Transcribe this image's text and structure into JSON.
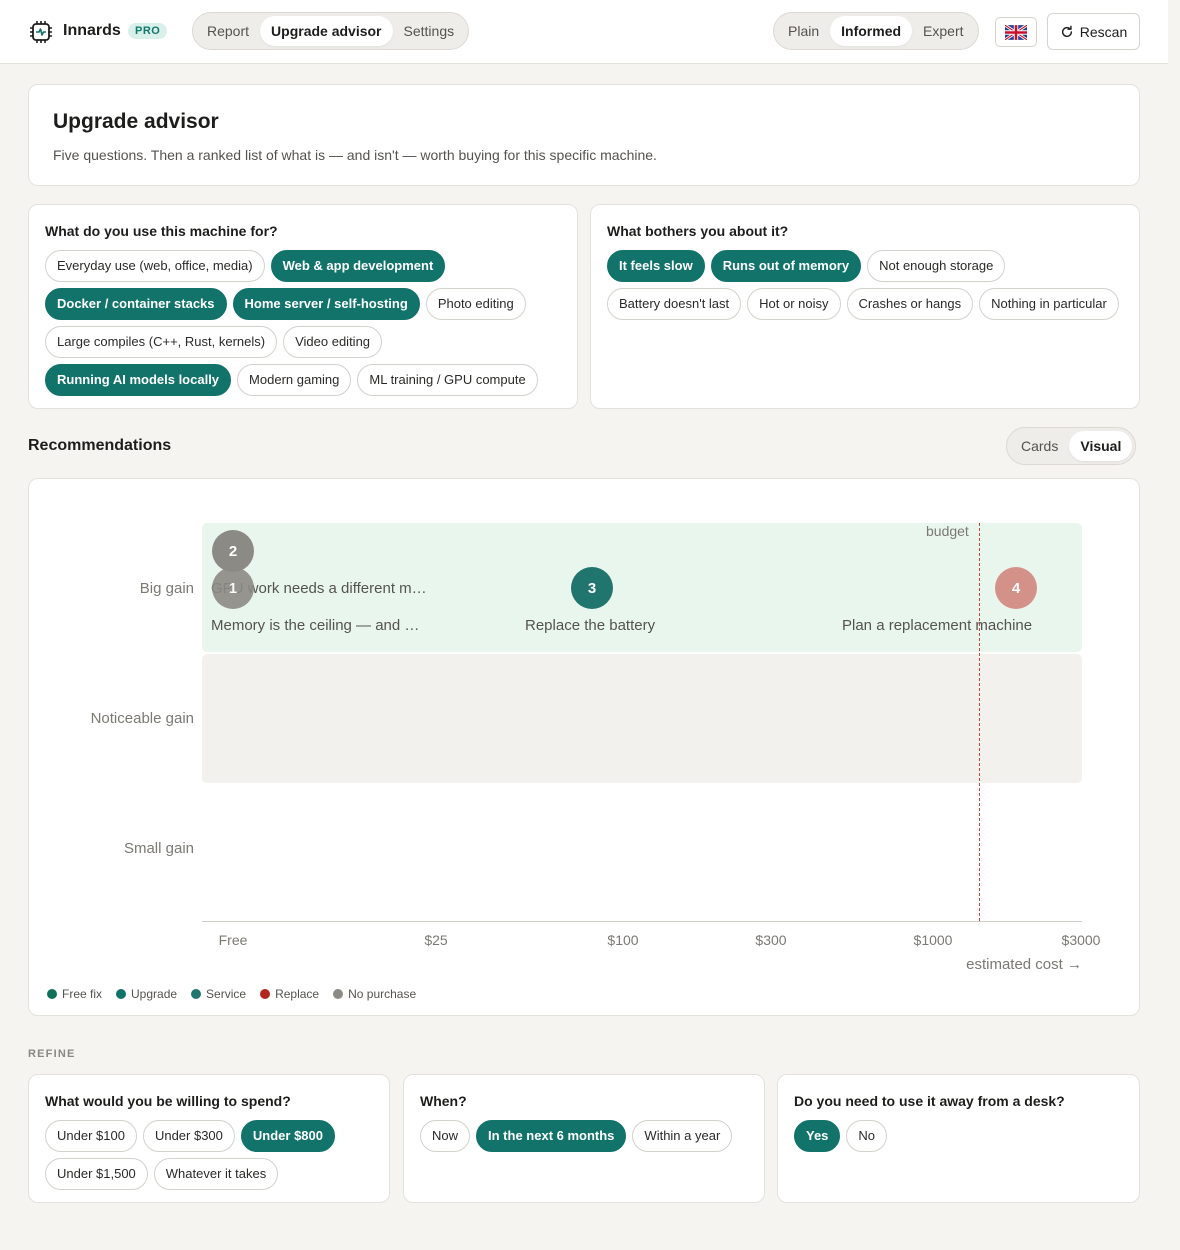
{
  "app": {
    "name": "Innards",
    "badge": "PRO"
  },
  "nav": {
    "tabs": [
      {
        "label": "Report"
      },
      {
        "label": "Upgrade advisor"
      },
      {
        "label": "Settings"
      }
    ]
  },
  "modes": {
    "items": [
      {
        "label": "Plain"
      },
      {
        "label": "Informed"
      },
      {
        "label": "Expert"
      }
    ]
  },
  "language": {
    "flag": "🇬🇧"
  },
  "rescan_label": "Rescan",
  "intro": {
    "title": "Upgrade advisor",
    "subtitle": "Five questions. Then a ranked list of what is — and isn't — worth buying for this specific machine."
  },
  "q_use": {
    "title": "What do you use this machine for?",
    "chips": [
      {
        "label": "Everyday use (web, office, media)",
        "on": false
      },
      {
        "label": "Web & app development",
        "on": true
      },
      {
        "label": "Docker / container stacks",
        "on": true
      },
      {
        "label": "Home server / self-hosting",
        "on": true
      },
      {
        "label": "Photo editing",
        "on": false
      },
      {
        "label": "Large compiles (C++, Rust, kernels)",
        "on": false
      },
      {
        "label": "Video editing",
        "on": false
      },
      {
        "label": "Running AI models locally",
        "on": true
      },
      {
        "label": "Modern gaming",
        "on": false
      },
      {
        "label": "ML training / GPU compute",
        "on": false
      }
    ]
  },
  "q_bother": {
    "title": "What bothers you about it?",
    "chips": [
      {
        "label": "It feels slow",
        "on": true
      },
      {
        "label": "Runs out of memory",
        "on": true
      },
      {
        "label": "Not enough storage",
        "on": false
      },
      {
        "label": "Battery doesn't last",
        "on": false
      },
      {
        "label": "Hot or noisy",
        "on": false
      },
      {
        "label": "Crashes or hangs",
        "on": false
      },
      {
        "label": "Nothing in particular",
        "on": false
      }
    ]
  },
  "recommendations": {
    "title": "Recommendations",
    "views": [
      {
        "label": "Cards"
      },
      {
        "label": "Visual"
      }
    ],
    "active_view": "Visual"
  },
  "chart_data": {
    "type": "scatter",
    "y_categories": [
      "Big gain",
      "Noticeable gain",
      "Small gain"
    ],
    "x_ticks": [
      "Free",
      "$25",
      "$100",
      "$300",
      "$1000",
      "$3000"
    ],
    "x_axis_label": "estimated cost →",
    "budget_label": "budget",
    "budget_value": "$800",
    "points": [
      {
        "rank": "1",
        "label": "Memory is the ceiling — and …",
        "cost": "Free",
        "gain": "Big gain",
        "kind": "No purchase",
        "color": "#8c8a84"
      },
      {
        "rank": "2",
        "label": "GPU work needs a different m…",
        "cost": "Free",
        "gain": "Big gain",
        "kind": "No purchase",
        "color": "#8c8a84"
      },
      {
        "rank": "3",
        "label": "Replace the battery",
        "cost": "$100",
        "gain": "Big gain",
        "kind": "Service",
        "color": "#21756f"
      },
      {
        "rank": "4",
        "label": "Plan a replacement machine",
        "cost": "$1500",
        "gain": "Big gain",
        "kind": "Replace",
        "color": "#d4918a"
      }
    ],
    "legend": [
      {
        "label": "Free fix",
        "color": "#0f6f57"
      },
      {
        "label": "Upgrade",
        "color": "#11736a"
      },
      {
        "label": "Service",
        "color": "#21756f"
      },
      {
        "label": "Replace",
        "color": "#b3261e"
      },
      {
        "label": "No purchase",
        "color": "#8c8a84"
      }
    ]
  },
  "refine": {
    "heading": "REFINE",
    "spend": {
      "title": "What would you be willing to spend?",
      "chips": [
        {
          "label": "Under $100",
          "on": false
        },
        {
          "label": "Under $300",
          "on": false
        },
        {
          "label": "Under $800",
          "on": true
        },
        {
          "label": "Under $1,500",
          "on": false
        },
        {
          "label": "Whatever it takes",
          "on": false
        }
      ]
    },
    "when": {
      "title": "When?",
      "chips": [
        {
          "label": "Now",
          "on": false
        },
        {
          "label": "In the next 6 months",
          "on": true
        },
        {
          "label": "Within a year",
          "on": false
        }
      ]
    },
    "away": {
      "title": "Do you need to use it away from a desk?",
      "chips": [
        {
          "label": "Yes",
          "on": true
        },
        {
          "label": "No",
          "on": false
        }
      ]
    }
  }
}
